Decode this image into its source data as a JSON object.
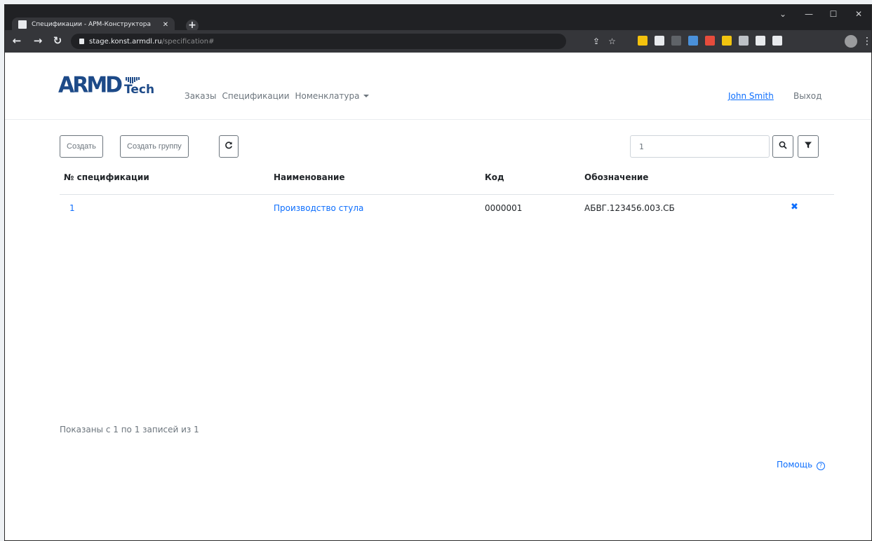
{
  "browser": {
    "tab_title": "Спецификации - АРМ-Конструктора",
    "tab_close": "✕",
    "new_tab": "+",
    "url_host": "stage.konst.armdl.ru",
    "url_path": "/specification#",
    "window_controls": [
      "⌄",
      "—",
      "☐",
      "✕"
    ],
    "extension_colors": [
      "#f4c20d",
      "#e8eaed",
      "#5f6368",
      "#4a90d9",
      "#e74c3c",
      "#f1c40f",
      "#bdc1c6",
      "#e8eaed",
      "#e8eaed"
    ]
  },
  "brand": {
    "logo_main": "ARMD",
    "logo_sub": "Tech",
    "color": "#1d4a88"
  },
  "nav": {
    "items": [
      {
        "label": "Заказы"
      },
      {
        "label": "Спецификации"
      },
      {
        "label": "Номенклатура"
      }
    ],
    "user": "John Smith",
    "logout": "Выход"
  },
  "actions": {
    "create": "Создать",
    "create_group": "Создать группу",
    "refresh_icon": "refresh-icon",
    "search_value": "1",
    "search_icon": "search-icon",
    "filter_icon": "filter-icon"
  },
  "table": {
    "columns": [
      "№ спецификации",
      "Наименование",
      "Код",
      "Обозначение"
    ],
    "rows": [
      {
        "number": "1",
        "name": "Производство стула",
        "code": "0000001",
        "designation": "АБВГ.123456.003.СБ"
      }
    ],
    "delete_glyph": "✖"
  },
  "footer": {
    "info": "Показаны с 1 по 1 записей из 1",
    "help": "Помощь",
    "help_glyph": "?"
  },
  "colors": {
    "accent": "#0d6efd",
    "muted": "#6c757d",
    "chrome_dark": "#202124"
  }
}
